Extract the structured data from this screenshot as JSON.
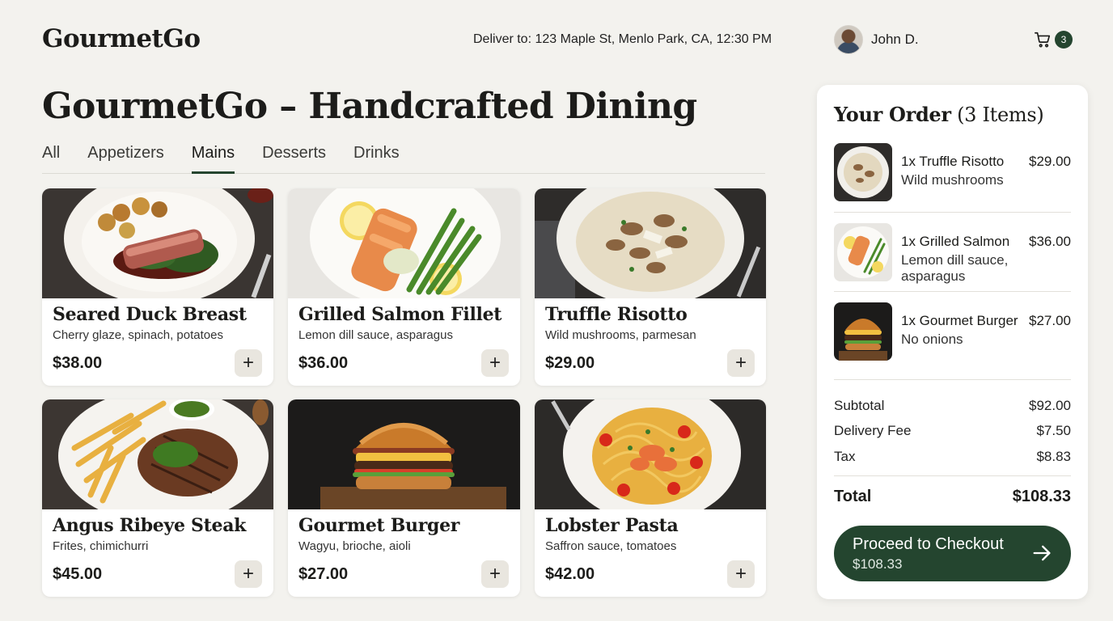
{
  "header": {
    "brand": "GourmetGo",
    "deliver": "Deliver to: 123 Maple St, Menlo Park, CA, 12:30 PM",
    "user_name": "John D.",
    "cart_count": "3",
    "accent": "#24452f"
  },
  "page": {
    "title_bold": "GourmetGo",
    "title_rest": " – Handcrafted Dining"
  },
  "tabs": [
    {
      "label": "All"
    },
    {
      "label": "Appetizers"
    },
    {
      "label": "Mains",
      "active": true
    },
    {
      "label": "Desserts"
    },
    {
      "label": "Drinks"
    }
  ],
  "menu": [
    {
      "title": "Seared Duck Breast",
      "desc": "Cherry glaze, spinach, potatoes",
      "price": "$38.00",
      "add": "+"
    },
    {
      "title": "Grilled Salmon Fillet",
      "desc": "Lemon dill sauce, asparagus",
      "price": "$36.00",
      "add": "+"
    },
    {
      "title": "Truffle Risotto",
      "desc": "Wild mushrooms, parmesan",
      "price": "$29.00",
      "add": "+"
    },
    {
      "title": "Angus Ribeye Steak",
      "desc": "Frites, chimichurri",
      "price": "$45.00",
      "add": "+"
    },
    {
      "title": "Gourmet Burger",
      "desc": "Wagyu, brioche, aioli",
      "price": "$27.00",
      "add": "+"
    },
    {
      "title": "Lobster Pasta",
      "desc": "Saffron sauce, tomatoes",
      "price": "$42.00",
      "add": "+"
    }
  ],
  "order": {
    "title_bold": "Your Order",
    "title_count": " (3 Items)",
    "items": [
      {
        "name": "1x Truffle Risotto",
        "desc": "Wild mushrooms",
        "price": "$29.00"
      },
      {
        "name": "1x Grilled Salmon",
        "desc": "Lemon dill sauce, asparagus",
        "price": "$36.00"
      },
      {
        "name": "1x Gourmet Burger",
        "desc": "No onions",
        "price": "$27.00"
      }
    ],
    "subtotal_label": "Subtotal",
    "subtotal": "$92.00",
    "delivery_label": "Delivery Fee",
    "delivery": "$7.50",
    "tax_label": "Tax",
    "tax": "$8.83",
    "total_label": "Total",
    "total": "$108.33",
    "checkout_label": "Proceed to Checkout",
    "checkout_amount": "$108.33"
  }
}
